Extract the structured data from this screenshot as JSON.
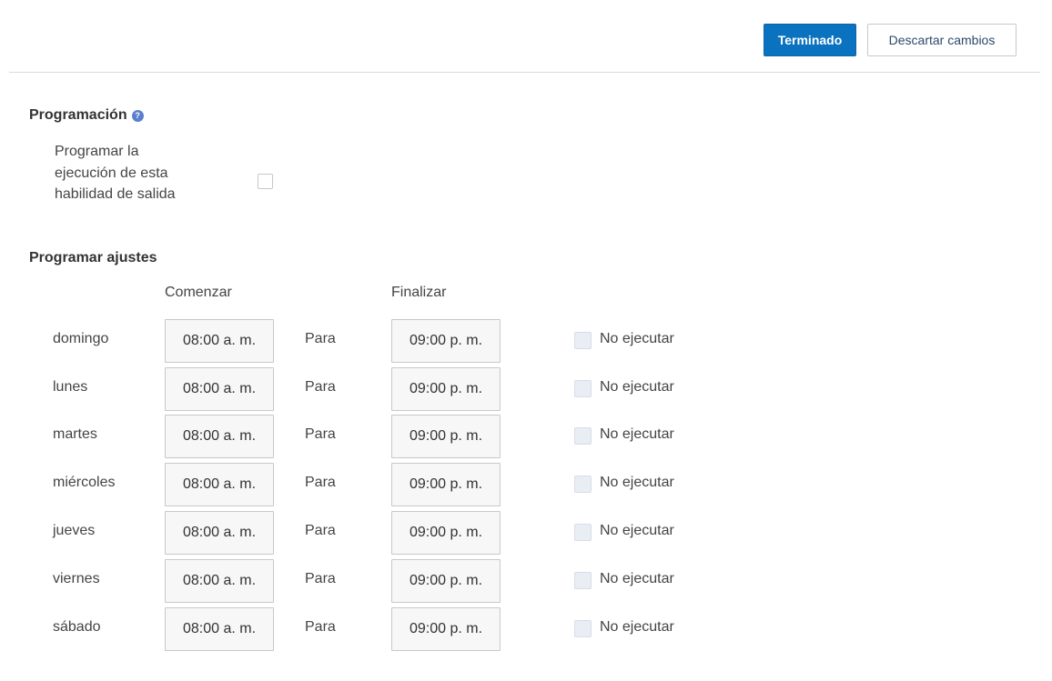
{
  "toolbar": {
    "done_label": "Terminado",
    "discard_label": "Descartar cambios"
  },
  "schedule": {
    "title": "Programación",
    "help_glyph": "?",
    "enable_label": "Programar la ejecución de esta habilidad de salida",
    "enabled": false
  },
  "settings": {
    "title": "Programar ajustes",
    "start_header": "Comenzar",
    "end_header": "Finalizar",
    "days": [
      {
        "day": "domingo",
        "start": "08:00 a. m.",
        "to": "Para",
        "end": "09:00 p. m.",
        "skip_label": "No ejecutar",
        "skip": false
      },
      {
        "day": "lunes",
        "start": "08:00 a. m.",
        "to": "Para",
        "end": "09:00 p. m.",
        "skip_label": "No ejecutar",
        "skip": false
      },
      {
        "day": "martes",
        "start": "08:00 a. m.",
        "to": "Para",
        "end": "09:00 p. m.",
        "skip_label": "No ejecutar",
        "skip": false
      },
      {
        "day": "miércoles",
        "start": "08:00 a. m.",
        "to": "Para",
        "end": "09:00 p. m.",
        "skip_label": "No ejecutar",
        "skip": false
      },
      {
        "day": "jueves",
        "start": "08:00 a. m.",
        "to": "Para",
        "end": "09:00 p. m.",
        "skip_label": "No ejecutar",
        "skip": false
      },
      {
        "day": "viernes",
        "start": "08:00 a. m.",
        "to": "Para",
        "end": "09:00 p. m.",
        "skip_label": "No ejecutar",
        "skip": false
      },
      {
        "day": "sábado",
        "start": "08:00 a. m.",
        "to": "Para",
        "end": "09:00 p. m.",
        "skip_label": "No ejecutar",
        "skip": false
      }
    ]
  },
  "colors": {
    "primary": "#0a72bf",
    "help_icon": "#5b7fcf"
  }
}
